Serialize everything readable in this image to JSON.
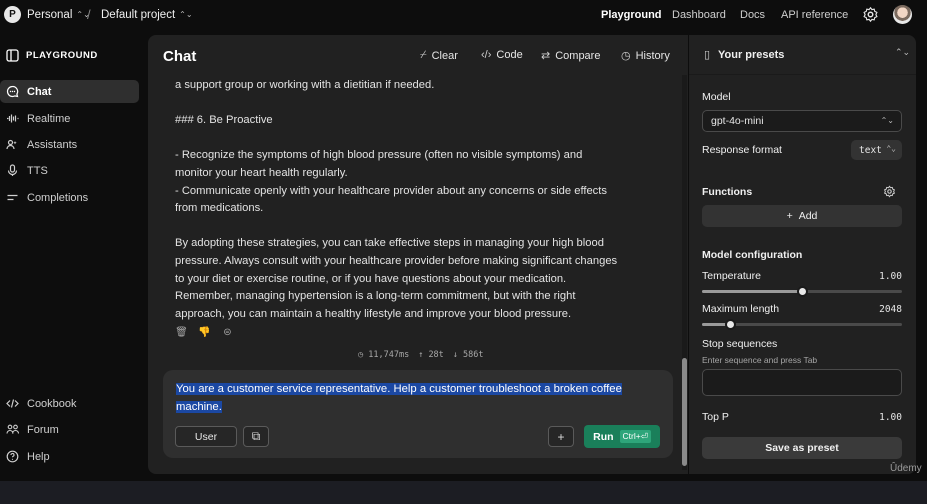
{
  "topbar": {
    "org_initial": "P",
    "org_name": "Personal",
    "separator": "/",
    "project_name": "Default project",
    "nav": [
      "Playground",
      "Dashboard",
      "Docs",
      "API reference"
    ],
    "active_nav": "Playground"
  },
  "sidebar": {
    "title": "PLAYGROUND",
    "items": [
      {
        "label": "Chat",
        "icon": "chat-bubble-icon",
        "active": true
      },
      {
        "label": "Realtime",
        "icon": "waveform-icon",
        "active": false
      },
      {
        "label": "Assistants",
        "icon": "assistants-icon",
        "active": false
      },
      {
        "label": "TTS",
        "icon": "microphone-icon",
        "active": false
      },
      {
        "label": "Completions",
        "icon": "lines-icon",
        "active": false
      }
    ],
    "bottom_items": [
      {
        "label": "Cookbook",
        "icon": "code-icon"
      },
      {
        "label": "Forum",
        "icon": "people-icon"
      },
      {
        "label": "Help",
        "icon": "question-icon"
      }
    ]
  },
  "chat": {
    "title": "Chat",
    "toolbar": {
      "clear": "Clear",
      "code": "Code",
      "compare": "Compare",
      "history": "History"
    },
    "message_lines": [
      "a support group or working with a dietitian if needed.",
      "",
      "### 6. Be Proactive",
      "",
      "- Recognize the symptoms of high blood pressure (often no visible symptoms) and",
      "monitor your heart health regularly.",
      "- Communicate openly with your healthcare provider about any concerns or side effects",
      "from medications.",
      "",
      "By adopting these strategies, you can take effective steps in managing your high blood",
      "pressure. Always consult with your healthcare provider before making significant changes",
      "to your diet or exercise routine, or if you have questions about your medication.",
      "Remember, managing hypertension is a long-term commitment, but with the right",
      "approach, you can maintain a healthy lifestyle and improve your blood pressure."
    ],
    "stats": {
      "latency": "11,747ms",
      "tokens_up": "↑ 28t",
      "tokens_down": "↓ 586t"
    },
    "input": {
      "text_line1": "You are a customer service representative. Help a customer troubleshoot a broken coffee",
      "text_line2": "machine.",
      "role": "User",
      "run_label": "Run",
      "run_shortcut": "Ctrl+⏎"
    }
  },
  "presets": {
    "label": "Your presets",
    "model_label": "Model",
    "model_value": "gpt-4o-mini",
    "response_format_label": "Response format",
    "response_format_value": "text",
    "functions_label": "Functions",
    "add_label": "Add",
    "model_config_label": "Model configuration",
    "temperature_label": "Temperature",
    "temperature_value": "1.00",
    "temperature_fraction": 0.5,
    "max_length_label": "Maximum length",
    "max_length_value": "2048",
    "max_length_fraction": 0.14,
    "stop_label": "Stop sequences",
    "stop_hint": "Enter sequence and press Tab",
    "top_p_label": "Top P",
    "top_p_value": "1.00",
    "save_label": "Save as preset"
  },
  "watermark": "Ûdemy"
}
